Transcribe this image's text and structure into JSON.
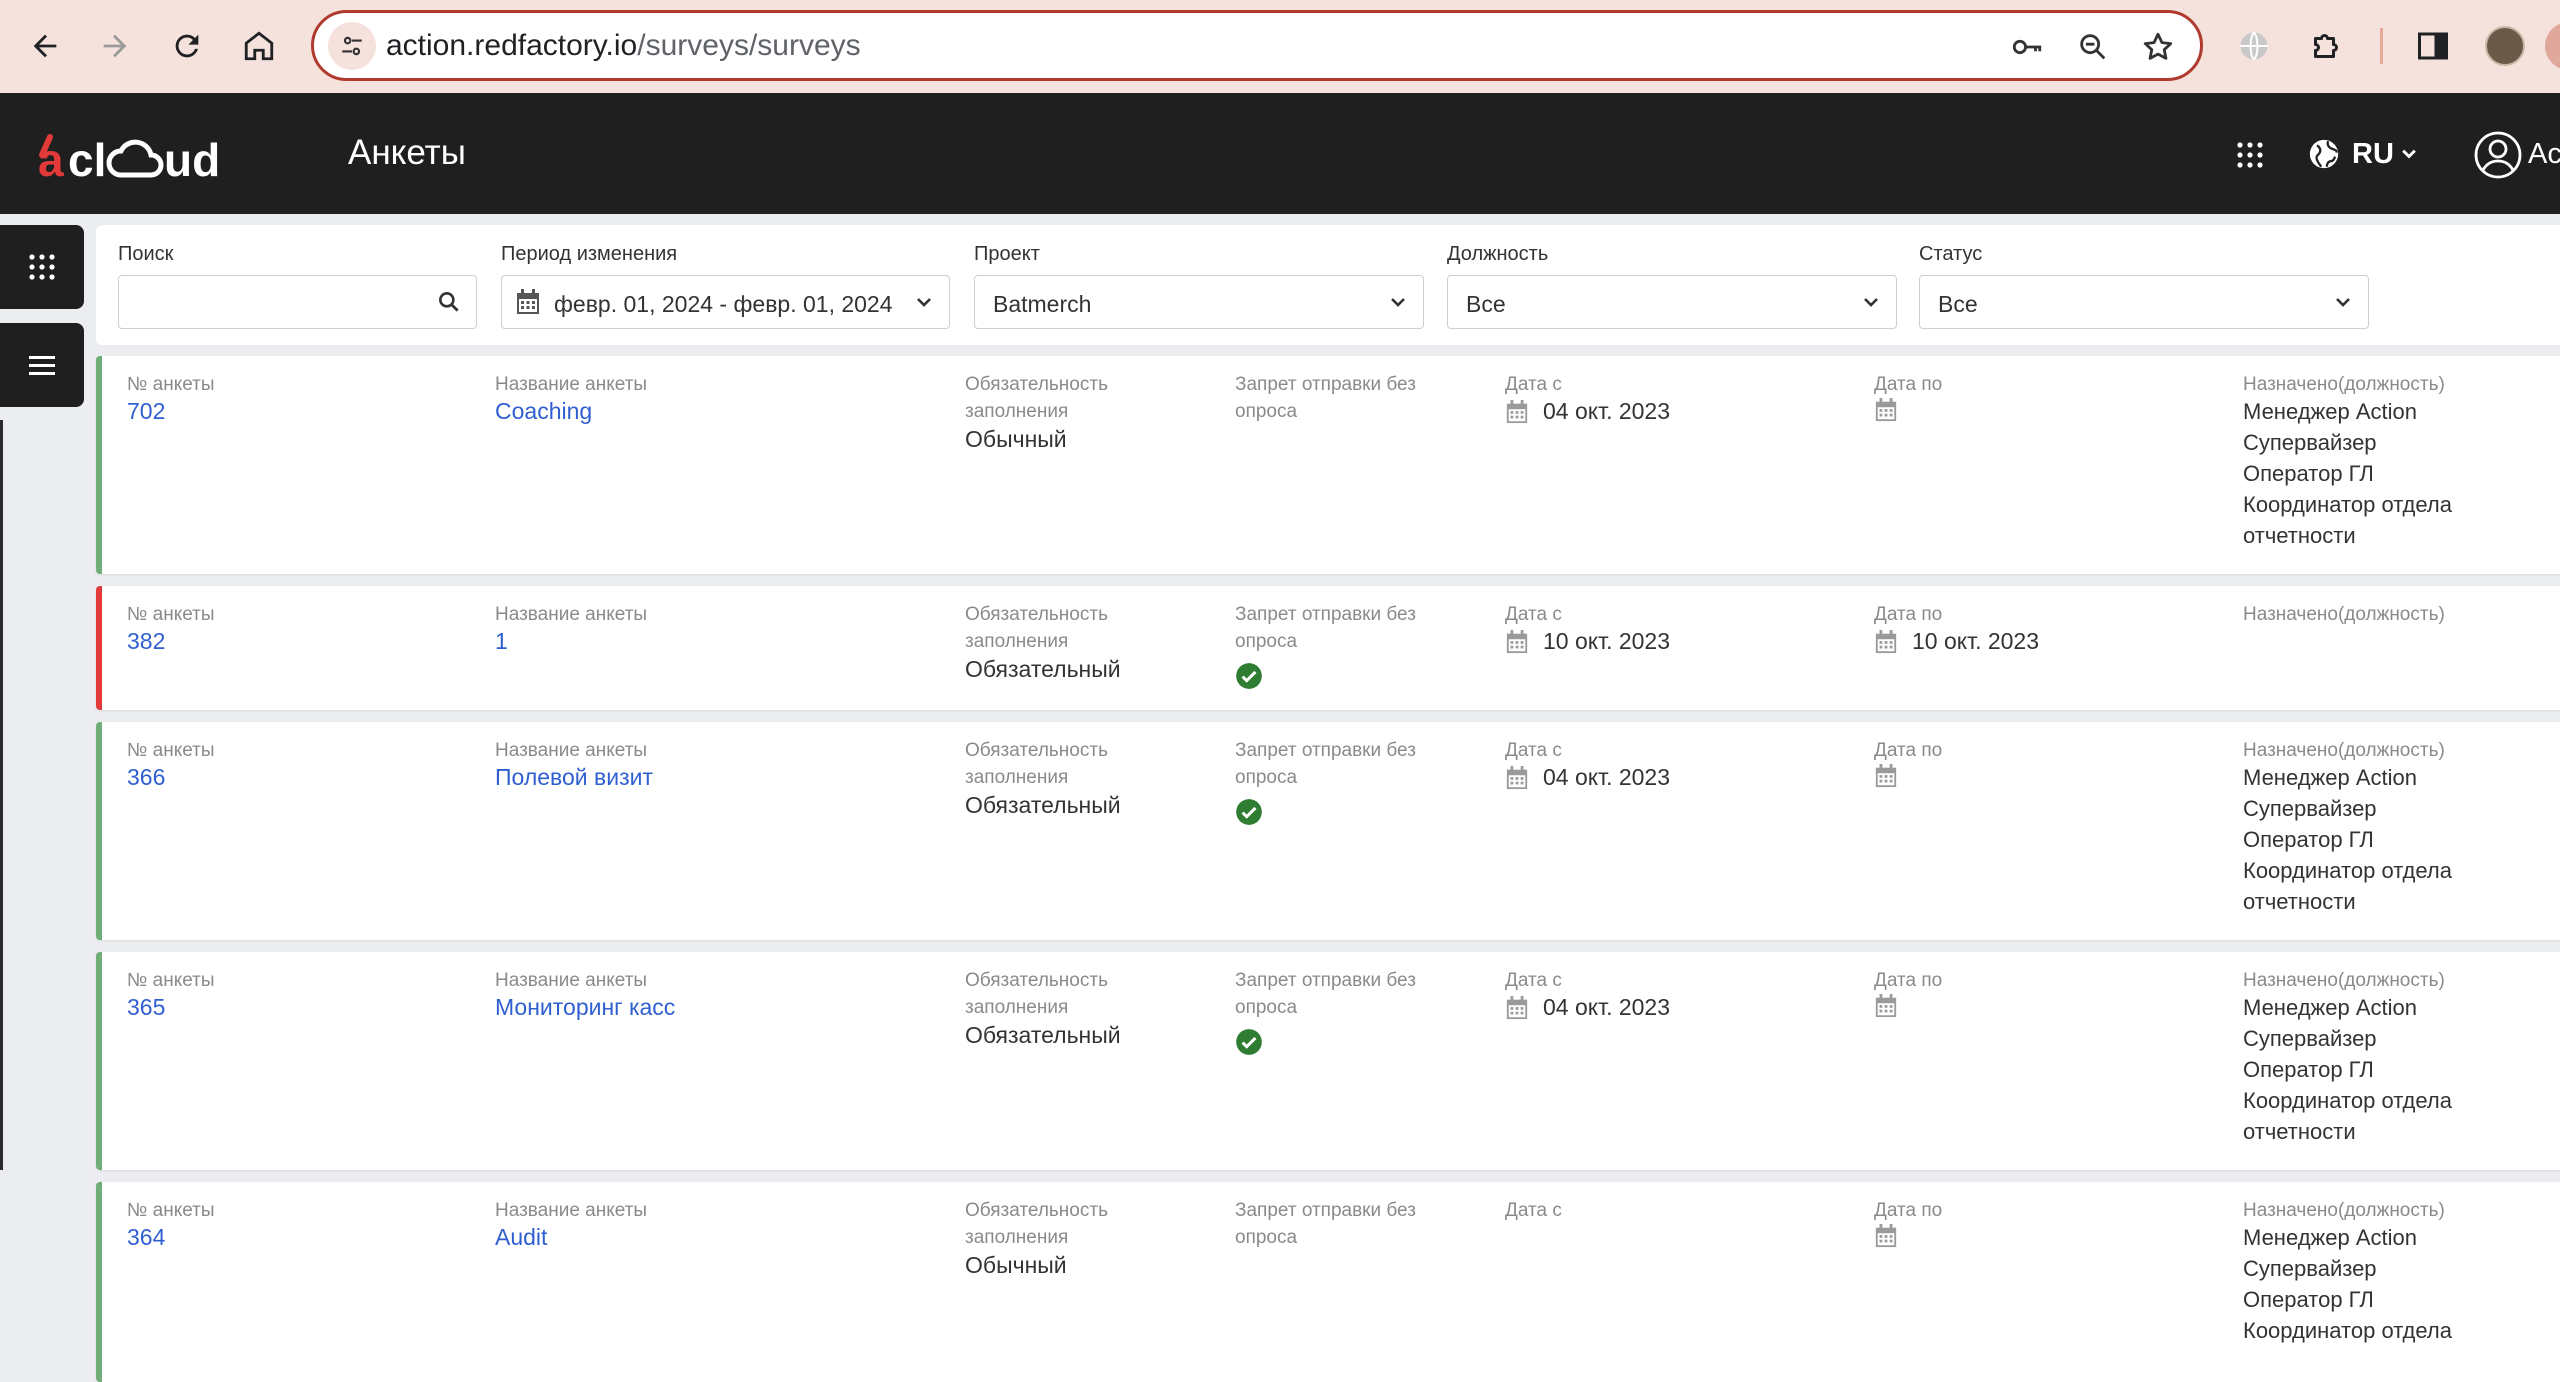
{
  "browser": {
    "url_domain": "action.redfactory.io",
    "url_path": "/surveys/surveys"
  },
  "app": {
    "logo_text": "acloud",
    "page_title": "Анкеты",
    "language": "RU",
    "user_label_partial": "Ac"
  },
  "filters": {
    "search": {
      "label": "Поиск",
      "value": ""
    },
    "period": {
      "label": "Период изменения",
      "value": "февр. 01, 2024 - февр. 01, 2024"
    },
    "project": {
      "label": "Проект",
      "value": "Batmerch"
    },
    "position": {
      "label": "Должность",
      "value": "Все"
    },
    "status": {
      "label": "Статус",
      "value": "Все"
    }
  },
  "columns": {
    "number": "№ анкеты",
    "name": "Название анкеты",
    "required_line1": "Обязательность",
    "required_line2": "заполнения",
    "noforbid_line1": "Запрет отправки без",
    "noforbid_line2": "опроса",
    "date_from": "Дата с",
    "date_to": "Дата по",
    "assigned": "Назначено(должность)"
  },
  "surveys": [
    {
      "number": "702",
      "name": "Coaching",
      "required": "Обычный",
      "no_submit_without": false,
      "date_from": "04 окт. 2023",
      "date_to": "",
      "roles": [
        "Менеджер Action",
        "Супервайзер",
        "Оператор ГЛ",
        "Координатор отдела",
        "отчетности"
      ],
      "status_color": "#6fae76"
    },
    {
      "number": "382",
      "name": "1",
      "required": "Обязательный",
      "no_submit_without": true,
      "date_from": "10 окт. 2023",
      "date_to": "10 окт. 2023",
      "roles": [],
      "status_color": "#e23a3a"
    },
    {
      "number": "366",
      "name": "Полевой визит",
      "required": "Обязательный",
      "no_submit_without": true,
      "date_from": "04 окт. 2023",
      "date_to": "",
      "roles": [
        "Менеджер Action",
        "Супервайзер",
        "Оператор ГЛ",
        "Координатор отдела",
        "отчетности"
      ],
      "status_color": "#6fae76"
    },
    {
      "number": "365",
      "name": "Мониторинг касс",
      "required": "Обязательный",
      "no_submit_without": true,
      "date_from": "04 окт. 2023",
      "date_to": "",
      "roles": [
        "Менеджер Action",
        "Супервайзер",
        "Оператор ГЛ",
        "Координатор отдела",
        "отчетности"
      ],
      "status_color": "#6fae76"
    },
    {
      "number": "364",
      "name": "Audit",
      "required": "Обычный",
      "no_submit_without": false,
      "date_from": "",
      "date_to": "",
      "roles": [
        "Менеджер Action",
        "Супервайзер",
        "Оператор ГЛ",
        "Координатор отдела"
      ],
      "status_color": "#6fae76"
    }
  ],
  "colors": {
    "accent_red": "#e23a3a",
    "link_blue": "#2f5fd0",
    "ok_green": "#2e7d32"
  },
  "icons": [
    "back-icon",
    "forward-icon",
    "reload-icon",
    "home-icon",
    "site-settings-icon",
    "key-icon",
    "zoom-icon",
    "star-icon",
    "translate-icon",
    "extensions-icon",
    "sidepanel-icon",
    "apps-grid-icon",
    "globe-icon",
    "chevron-down-icon",
    "user-circle-icon",
    "menu-icon",
    "search-icon",
    "calendar-icon",
    "check-circle-icon"
  ]
}
